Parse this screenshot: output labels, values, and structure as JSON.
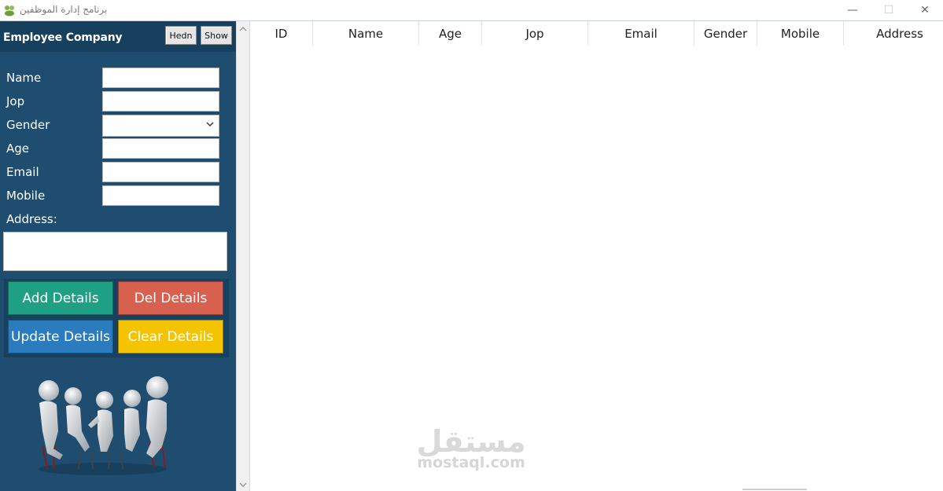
{
  "window": {
    "title": "برنامج إدارة الموظفين",
    "controls": {
      "minimize": "—",
      "maximize": "☐",
      "close": "✕"
    }
  },
  "sidebar": {
    "company": "Employee Company",
    "hedn_label": "Hedn",
    "show_label": "Show",
    "fields": {
      "name": "Name",
      "jop": "Jop",
      "gender": "Gender",
      "age": "Age",
      "email": "Email",
      "mobile": "Mobile",
      "address": "Address:"
    },
    "buttons": {
      "add": "Add Details",
      "del": "Del Details",
      "update": "Update Details",
      "clear": "Clear Details"
    },
    "colors": {
      "panel": "#1f4d6f",
      "add": "#1fa085",
      "del": "#d8604f",
      "update": "#2b7cbf",
      "clear": "#f5c400"
    }
  },
  "table": {
    "columns": [
      "ID",
      "Name",
      "Age",
      "Jop",
      "Email",
      "Gender",
      "Mobile",
      "Address"
    ]
  },
  "watermark": {
    "arabic": "مستقل",
    "english": "mostaql.com"
  }
}
